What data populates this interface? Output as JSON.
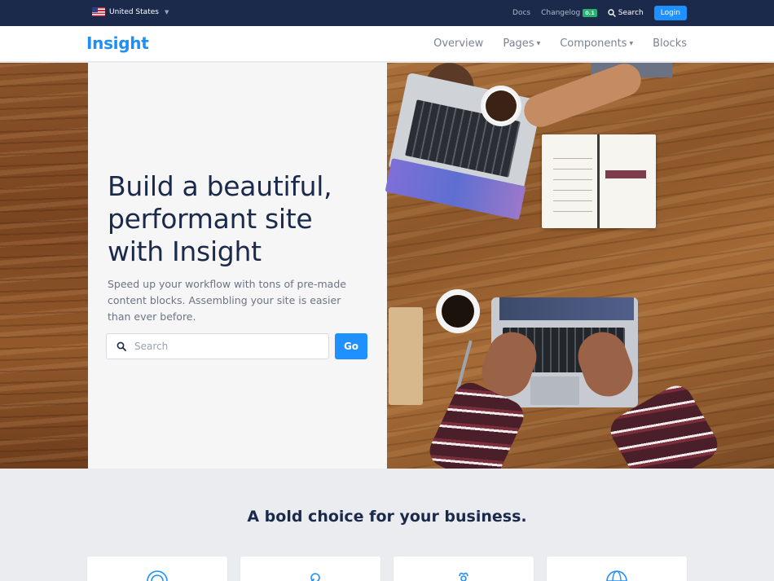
{
  "topbar": {
    "country": "United States",
    "links": {
      "docs": "Docs",
      "changelog": "Changelog",
      "changelog_badge": "0.1",
      "search": "Search",
      "login": "Login"
    }
  },
  "navbar": {
    "brand": "Insight",
    "items": [
      {
        "label": "Overview",
        "has_dropdown": false
      },
      {
        "label": "Pages",
        "has_dropdown": true
      },
      {
        "label": "Components",
        "has_dropdown": true
      },
      {
        "label": "Blocks",
        "has_dropdown": false
      }
    ]
  },
  "hero": {
    "title": "Build a beautiful, performant site with Insight",
    "subtitle": "Speed up your workflow with tons of pre-made content blocks. Assembling your site is easier than ever before.",
    "search_placeholder": "Search",
    "go_label": "Go"
  },
  "section": {
    "title": "A bold choice for your business.",
    "cards": [
      {
        "icon": "target-icon"
      },
      {
        "icon": "tools-icon"
      },
      {
        "icon": "flower-icon"
      },
      {
        "icon": "globe-icon"
      }
    ]
  },
  "colors": {
    "topbar_bg": "#1b2a4b",
    "accent": "#1e90ff",
    "brand": "#1f8ff3",
    "heading": "#1b2a4b",
    "badge": "#27b36b"
  }
}
